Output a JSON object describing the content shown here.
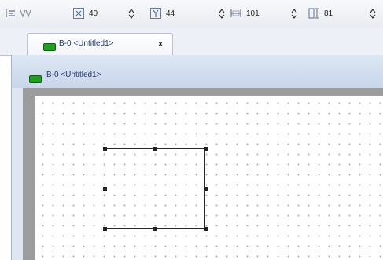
{
  "toolbar": {
    "x_value": "40",
    "y_value": "44",
    "width_value": "101",
    "height_value": "81"
  },
  "document_tab": {
    "label": "B-0 <Untitled1>",
    "close": "x"
  },
  "frame": {
    "title": "B-0 <Untitled1>"
  },
  "colors": {
    "icon_green": "#1fa01f",
    "tab_text": "#1e3a6e",
    "canvas_border": "#9c9c9c"
  },
  "icons": [
    "align-left-icon",
    "text-icon",
    "x-position-icon",
    "y-position-icon",
    "width-icon",
    "height-icon",
    "chevron-updown-icon",
    "block-icon"
  ]
}
